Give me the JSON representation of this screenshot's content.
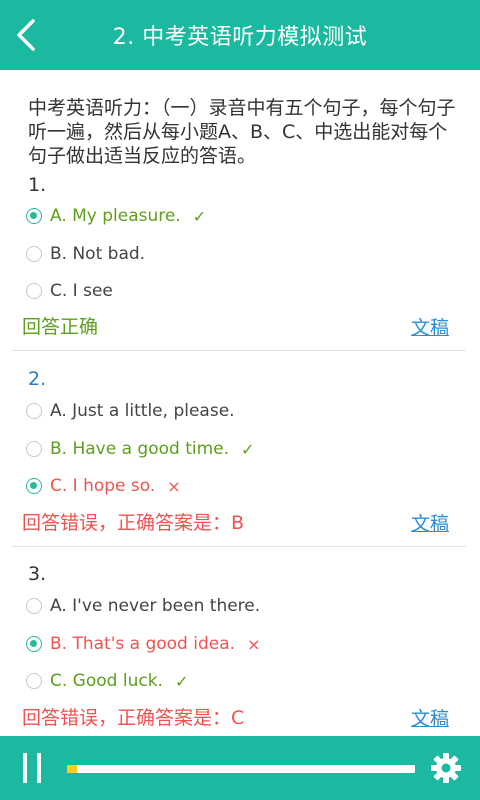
{
  "header": {
    "title": "2. 中考英语听力模拟测试",
    "back_icon": "back-chevron-icon"
  },
  "intro": "中考英语听力：（一）录音中有五个句子，每个句子听一遍，然后从每小题A、B、C、中选出能对每个句子做出适当反应的答语。",
  "questions": [
    {
      "number": "1.",
      "options": [
        "A. My pleasure.",
        "B. Not bad.",
        "C. I see"
      ],
      "selected": "A",
      "correct": "A",
      "marks": [
        "✓",
        "",
        ""
      ],
      "result": "回答正确",
      "script_label": "文稿"
    },
    {
      "number": "2.",
      "options": [
        "A. Just a little, please.",
        "B. Have a good time.",
        "C. I hope so."
      ],
      "selected": "C",
      "correct": "B",
      "marks": [
        "",
        "✓",
        "×"
      ],
      "result": "回答错误，正确答案是：B",
      "script_label": "文稿"
    },
    {
      "number": "3.",
      "options": [
        "A. I've never been there.",
        "B. That's a good idea.",
        "C. Good luck."
      ],
      "selected": "B",
      "correct": "C",
      "marks": [
        "",
        "×",
        "✓"
      ],
      "result": "回答错误，正确答案是：C",
      "script_label": "文稿"
    }
  ],
  "player": {
    "progress": 0.03,
    "pause_icon": "pause-icon",
    "settings_icon": "gear-icon"
  },
  "colors": {
    "accent": "#1bb9a0",
    "correct": "#5e9e1e",
    "wrong": "#ef5350",
    "link": "#2a8fd6",
    "progress_fill": "#f2d21b"
  }
}
